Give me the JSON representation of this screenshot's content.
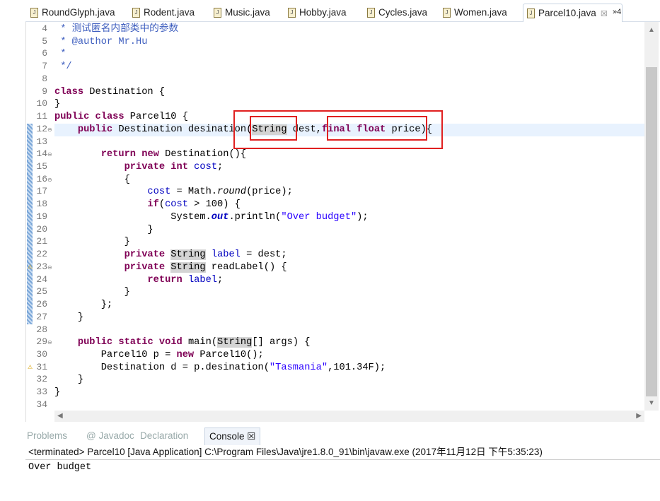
{
  "tabs": [
    {
      "label": "RoundGlyph.java"
    },
    {
      "label": "Rodent.java"
    },
    {
      "label": "Music.java"
    },
    {
      "label": "Hobby.java"
    },
    {
      "label": "Cycles.java"
    },
    {
      "label": "Women.java"
    },
    {
      "label": "Parcel10.java",
      "active": true
    }
  ],
  "tab_overflow": "»4",
  "tab_close": "☒",
  "editor": {
    "current_line": 12,
    "lines": [
      {
        "n": 4,
        "t": [
          [
            " * 测试匿名内部类中的参数",
            "com"
          ]
        ]
      },
      {
        "n": 5,
        "t": [
          [
            " * @author Mr.Hu",
            "com"
          ]
        ]
      },
      {
        "n": 6,
        "t": [
          [
            " *",
            "com"
          ]
        ]
      },
      {
        "n": 7,
        "t": [
          [
            " */",
            "com"
          ]
        ]
      },
      {
        "n": 8,
        "t": []
      },
      {
        "n": 9,
        "t": [
          [
            "class",
            "kw"
          ],
          [
            " Destination {",
            ""
          ]
        ]
      },
      {
        "n": 10,
        "t": [
          [
            "}",
            ""
          ]
        ]
      },
      {
        "n": 11,
        "t": [
          [
            "public",
            "kw"
          ],
          [
            " ",
            ""
          ],
          [
            "class",
            "kw"
          ],
          [
            " Parcel10 {",
            ""
          ]
        ]
      },
      {
        "n": 12,
        "mark": true,
        "fold": true,
        "t": [
          [
            "    ",
            ""
          ],
          [
            "public",
            "kw"
          ],
          [
            " Destination desination(",
            ""
          ],
          [
            "String",
            "hl"
          ],
          [
            " dest,",
            ""
          ],
          [
            "final",
            "kw"
          ],
          [
            " ",
            ""
          ],
          [
            "float",
            "kw"
          ],
          [
            " price){",
            ""
          ]
        ]
      },
      {
        "n": 13,
        "mark": true,
        "t": []
      },
      {
        "n": 14,
        "mark": true,
        "fold": true,
        "t": [
          [
            "        ",
            ""
          ],
          [
            "return",
            "kw"
          ],
          [
            " ",
            ""
          ],
          [
            "new",
            "kw"
          ],
          [
            " Destination(){",
            ""
          ]
        ]
      },
      {
        "n": 15,
        "mark": true,
        "t": [
          [
            "            ",
            ""
          ],
          [
            "private",
            "kw"
          ],
          [
            " ",
            ""
          ],
          [
            "int",
            "kw"
          ],
          [
            " ",
            ""
          ],
          [
            "cost",
            "field"
          ],
          [
            ";",
            ""
          ]
        ]
      },
      {
        "n": 16,
        "mark": true,
        "fold": true,
        "t": [
          [
            "            {",
            ""
          ]
        ]
      },
      {
        "n": 17,
        "mark": true,
        "t": [
          [
            "                ",
            ""
          ],
          [
            "cost",
            "field"
          ],
          [
            " = Math.",
            ""
          ],
          [
            "round",
            "ital"
          ],
          [
            "(price);",
            ""
          ]
        ]
      },
      {
        "n": 18,
        "mark": true,
        "t": [
          [
            "                ",
            ""
          ],
          [
            "if",
            "kw"
          ],
          [
            "(",
            ""
          ],
          [
            "cost",
            "field"
          ],
          [
            " > 100) {",
            ""
          ]
        ]
      },
      {
        "n": 19,
        "mark": true,
        "t": [
          [
            "                    System.",
            ""
          ],
          [
            "out",
            "static"
          ],
          [
            ".println(",
            ""
          ],
          [
            "\"Over budget\"",
            "str"
          ],
          [
            ");",
            ""
          ]
        ]
      },
      {
        "n": 20,
        "mark": true,
        "t": [
          [
            "                }",
            ""
          ]
        ]
      },
      {
        "n": 21,
        "mark": true,
        "t": [
          [
            "            }",
            ""
          ]
        ]
      },
      {
        "n": 22,
        "mark": true,
        "t": [
          [
            "            ",
            ""
          ],
          [
            "private",
            "kw"
          ],
          [
            " ",
            ""
          ],
          [
            "String",
            "hl"
          ],
          [
            " ",
            ""
          ],
          [
            "label",
            "field"
          ],
          [
            " = dest;",
            ""
          ]
        ]
      },
      {
        "n": 23,
        "mark": true,
        "fold": true,
        "warn": true,
        "t": [
          [
            "            ",
            ""
          ],
          [
            "private",
            "kw"
          ],
          [
            " ",
            ""
          ],
          [
            "String",
            "hl"
          ],
          [
            " readLabel() {",
            ""
          ]
        ]
      },
      {
        "n": 24,
        "mark": true,
        "t": [
          [
            "                ",
            ""
          ],
          [
            "return",
            "kw"
          ],
          [
            " ",
            ""
          ],
          [
            "label",
            "field"
          ],
          [
            ";",
            ""
          ]
        ]
      },
      {
        "n": 25,
        "mark": true,
        "t": [
          [
            "            }",
            ""
          ]
        ]
      },
      {
        "n": 26,
        "mark": true,
        "t": [
          [
            "        };",
            ""
          ]
        ]
      },
      {
        "n": 27,
        "mark": true,
        "t": [
          [
            "    }",
            ""
          ]
        ]
      },
      {
        "n": 28,
        "t": []
      },
      {
        "n": 29,
        "fold": true,
        "t": [
          [
            "    ",
            ""
          ],
          [
            "public",
            "kw"
          ],
          [
            " ",
            ""
          ],
          [
            "static",
            "kw"
          ],
          [
            " ",
            ""
          ],
          [
            "void",
            "kw"
          ],
          [
            " main(",
            ""
          ],
          [
            "String",
            "hl"
          ],
          [
            "[] args) {",
            ""
          ]
        ]
      },
      {
        "n": 30,
        "t": [
          [
            "        Parcel10 p = ",
            ""
          ],
          [
            "new",
            "kw"
          ],
          [
            " Parcel10();",
            ""
          ]
        ]
      },
      {
        "n": 31,
        "warn": true,
        "t": [
          [
            "        Destination d = p.desination(",
            ""
          ],
          [
            "\"Tasmania\"",
            "str"
          ],
          [
            ",101.34F);",
            ""
          ]
        ]
      },
      {
        "n": 32,
        "t": [
          [
            "    }",
            ""
          ]
        ]
      },
      {
        "n": 33,
        "t": [
          [
            "}",
            ""
          ]
        ]
      },
      {
        "n": 34,
        "t": []
      }
    ]
  },
  "views": [
    {
      "label": "Problems"
    },
    {
      "label": "@ Javadoc"
    },
    {
      "label": "Declaration"
    },
    {
      "label": "Console ☒",
      "active": true
    }
  ],
  "console": {
    "status": "<terminated> Parcel10 [Java Application] C:\\Program Files\\Java\\jre1.8.0_91\\bin\\javaw.exe (2017年11月12日 下午5:35:23)",
    "output": "Over budget"
  },
  "colors": {
    "keyword": "#7f0055",
    "field": "#0000c0",
    "string": "#2a00ff",
    "comment": "#3f5fbf",
    "annotation_box": "#e02020"
  }
}
